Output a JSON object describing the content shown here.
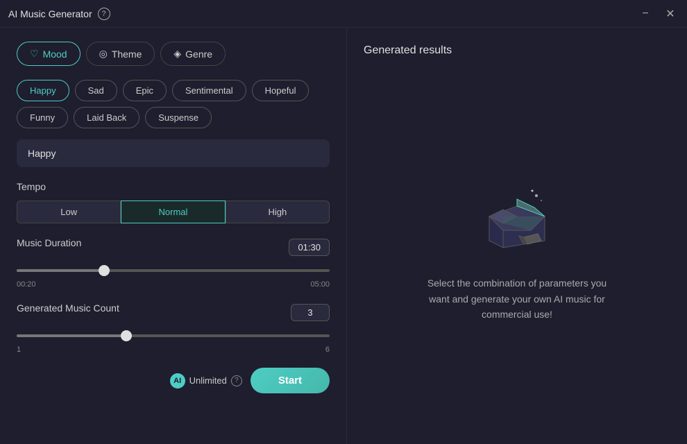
{
  "titleBar": {
    "title": "AI Music Generator",
    "infoLabel": "?"
  },
  "tabs": [
    {
      "id": "mood",
      "label": "Mood",
      "icon": "♡",
      "active": true
    },
    {
      "id": "theme",
      "label": "Theme",
      "icon": "◎",
      "active": false
    },
    {
      "id": "genre",
      "label": "Genre",
      "icon": "◈",
      "active": false
    }
  ],
  "moods": [
    {
      "label": "Happy",
      "selected": true
    },
    {
      "label": "Sad",
      "selected": false
    },
    {
      "label": "Epic",
      "selected": false
    },
    {
      "label": "Sentimental",
      "selected": false
    },
    {
      "label": "Hopeful",
      "selected": false
    },
    {
      "label": "Funny",
      "selected": false
    },
    {
      "label": "Laid Back",
      "selected": false
    },
    {
      "label": "Suspense",
      "selected": false
    }
  ],
  "selectedMood": "Happy",
  "tempo": {
    "label": "Tempo",
    "options": [
      "Low",
      "Normal",
      "High"
    ],
    "selected": "Normal"
  },
  "musicDuration": {
    "label": "Music Duration",
    "min": "00:20",
    "max": "05:00",
    "value": "01:30",
    "fillPercent": 28
  },
  "musicCount": {
    "label": "Generated Music Count",
    "min": "1",
    "max": "6",
    "value": "3",
    "fillPercent": 35
  },
  "bottomBar": {
    "unlimitedLabel": "Unlimited",
    "unlimitedIcon": "AI",
    "startLabel": "Start"
  },
  "rightPanel": {
    "title": "Generated results",
    "description": "Select the combination of parameters you want and generate your own AI music for commercial use!"
  }
}
